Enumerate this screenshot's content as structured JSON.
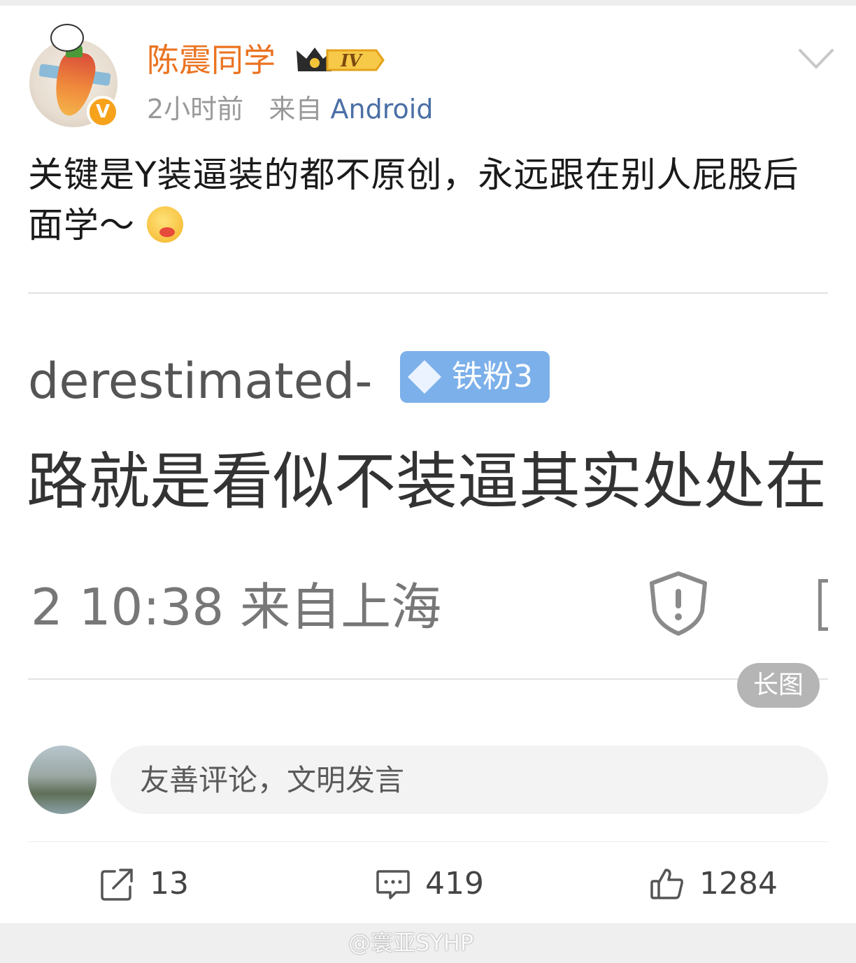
{
  "post": {
    "author": "陈震同学",
    "level_badge": "IV",
    "verified_mark": "V",
    "time": "2小时前",
    "source_prefix": "来自",
    "source": "Android",
    "text": "关键是Y装逼装的都不原创，永远跟在别人屁股后面学～",
    "emoji": "drooling-watermelon-emoji"
  },
  "embedded": {
    "username_partial": "derestimated-",
    "fan_badge": "铁粉3",
    "text_partial": "路就是看似不装逼其实处处在",
    "time_partial": "2 10:38  来自上海",
    "long_image_label": "长图"
  },
  "comment": {
    "placeholder": "友善评论，文明发言"
  },
  "actions": {
    "reposts": "13",
    "comments": "419",
    "likes": "1284"
  },
  "watermark": "@寰亚SYHP",
  "colors": {
    "username": "#eb7320",
    "source_link": "#4a6fa5",
    "badge_blue": "#7cb0ea",
    "verified": "#f6a21b"
  }
}
